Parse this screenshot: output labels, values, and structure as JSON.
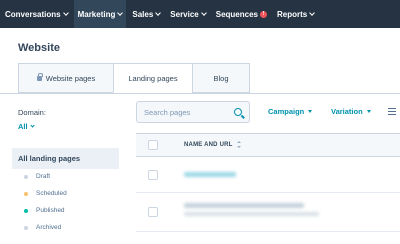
{
  "nav": {
    "items": [
      {
        "label": "Conversations",
        "active": false
      },
      {
        "label": "Marketing",
        "active": true
      },
      {
        "label": "Sales",
        "active": false
      },
      {
        "label": "Service",
        "active": false
      },
      {
        "label": "Sequences",
        "active": false,
        "badge": "!"
      },
      {
        "label": "Reports",
        "active": false
      }
    ],
    "colors": {
      "bar": "#253342",
      "active": "#33475b",
      "badge": "#f2545b"
    }
  },
  "page": {
    "title": "Website"
  },
  "tabs": [
    {
      "label": "Website pages",
      "icon": "lock-icon",
      "active": false
    },
    {
      "label": "Landing pages",
      "active": true
    },
    {
      "label": "Blog",
      "active": false
    }
  ],
  "filters": {
    "domain_label": "Domain:",
    "domain_value": "All",
    "all_label": "All landing pages",
    "items": [
      {
        "label": "Draft",
        "color": "#cbd6e2"
      },
      {
        "label": "Scheduled",
        "color": "#f5c26b"
      },
      {
        "label": "Published",
        "color": "#00bda5"
      },
      {
        "label": "Archived",
        "color": "#cbd6e2"
      }
    ]
  },
  "toolbar": {
    "search_placeholder": "Search pages",
    "campaign_label": "Campaign",
    "variation_label": "Variation"
  },
  "table": {
    "columns": [
      "NAME AND URL"
    ]
  },
  "colors": {
    "accent": "#0091ae",
    "text": "#33475b"
  }
}
